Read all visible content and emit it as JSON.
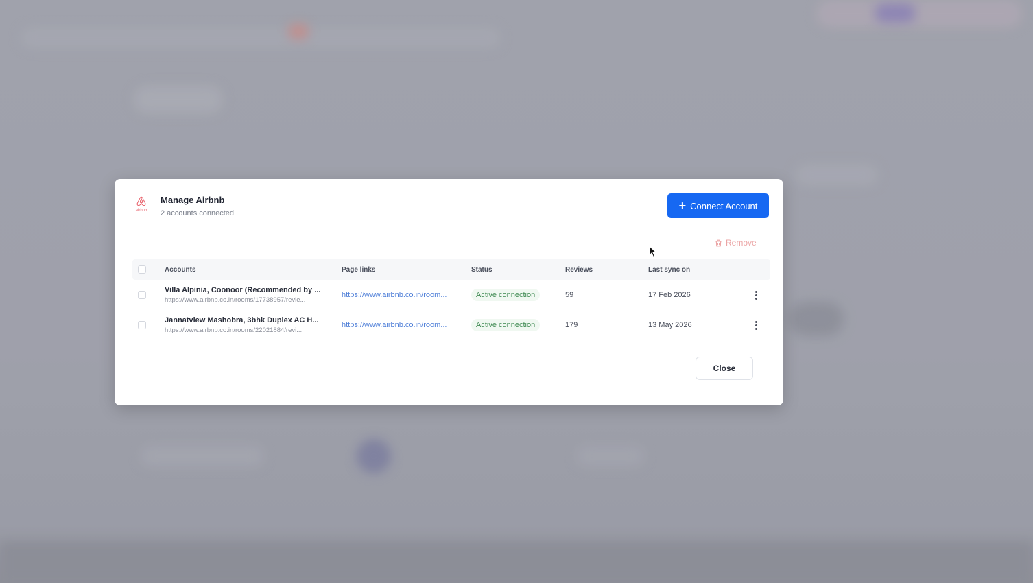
{
  "modal": {
    "title": "Manage Airbnb",
    "subtitle": "2 accounts connected",
    "logo_text": "airbnb",
    "connect_button": "Connect Account",
    "remove_button": "Remove",
    "close_button": "Close"
  },
  "table": {
    "headers": {
      "accounts": "Accounts",
      "page_links": "Page links",
      "status": "Status",
      "reviews": "Reviews",
      "last_sync": "Last sync on"
    },
    "rows": [
      {
        "name": "Villa Alpinia, Coonoor (Recommended by ...",
        "url": "https://www.airbnb.co.in/rooms/17738957/revie...",
        "page_link": "https://www.airbnb.co.in/room...",
        "status": "Active connection",
        "reviews": "59",
        "last_sync": "17 Feb 2026"
      },
      {
        "name": "Jannatview Mashobra, 3bhk Duplex AC H...",
        "url": "https://www.airbnb.co.in/rooms/22021884/revi...",
        "page_link": "https://www.airbnb.co.in/room...",
        "status": "Active connection",
        "reviews": "179",
        "last_sync": "13 May 2026"
      }
    ]
  },
  "colors": {
    "primary": "#1668f2",
    "airbnb": "#e8616b",
    "status_green": "#3f8a52",
    "remove_red": "#eba4a4"
  },
  "icons": {
    "logo": "airbnb-logo-icon",
    "connect": "plus-icon",
    "remove": "trash-icon",
    "row_menu": "more-vertical-icon",
    "cursor": "mouse-pointer-icon"
  }
}
